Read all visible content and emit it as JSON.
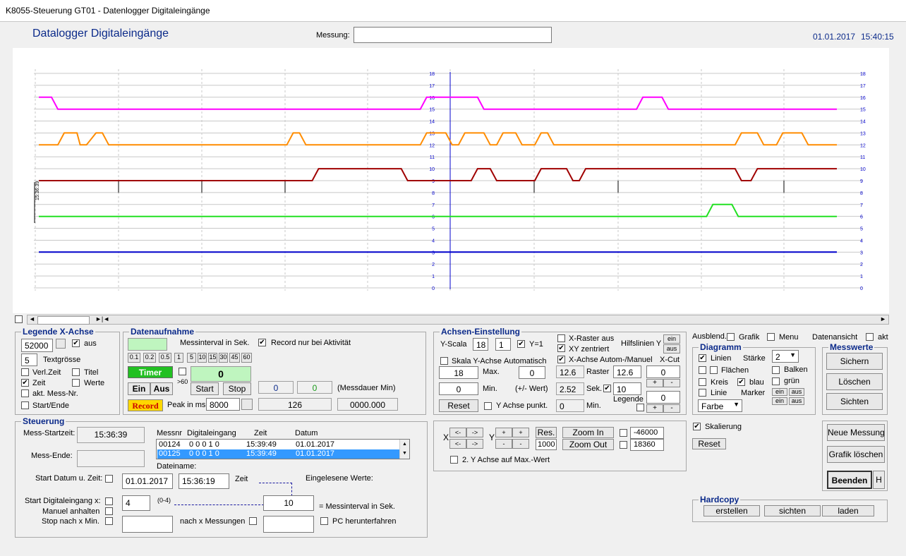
{
  "window": {
    "title": "K8055-Steuerung GT01 - Datenlogger Digitaleingänge"
  },
  "header": {
    "app_title": "Datalogger Digitaleingänge",
    "messung_label": "Messung:",
    "messung_value": "",
    "date": "01.01.2017",
    "time": "15:40:15"
  },
  "colors": {
    "magenta": "#ff00ff",
    "orange": "#ff8c00",
    "red": "#dd0000",
    "dark_red": "#a00000",
    "green": "#22e022",
    "blue": "#0000cc",
    "axis_text": "#0000cc",
    "title_blue": "#0b2a8a"
  },
  "chart_data": {
    "type": "line",
    "ylim": [
      0,
      18
    ],
    "yticks": [
      "0",
      "1",
      "2",
      "3",
      "4",
      "5",
      "6",
      "7",
      "8",
      "9",
      "10",
      "11",
      "12",
      "13",
      "14",
      "15",
      "16",
      "17",
      "18"
    ],
    "marker_label": "15:36:39",
    "series": [
      {
        "x": [
          0,
          15,
          25,
          430,
          440,
          570,
          580,
          680,
          690,
          710,
          720,
          760,
          770,
          780,
          790,
          830,
          840,
          850,
          860,
          1095,
          1105,
          1120,
          1130,
          1255
        ],
        "values": [
          9,
          9,
          9,
          9,
          10,
          10,
          9,
          9,
          10,
          10,
          9,
          9,
          9,
          9,
          10,
          10,
          9,
          9,
          10,
          10,
          9,
          9,
          10,
          10
        ]
      },
      {
        "x": [
          0,
          30,
          40,
          60,
          65,
          75,
          90,
          100,
          110,
          160,
          180,
          390,
          400,
          410,
          420,
          600,
          610,
          640,
          650,
          660,
          670,
          700,
          710,
          720,
          730,
          750,
          760,
          780,
          790,
          800,
          810,
          1095,
          1105,
          1130,
          1140,
          1160,
          1170,
          1200,
          1210,
          1255
        ],
        "values": [
          12,
          12,
          13,
          13,
          12,
          12,
          13,
          13,
          12,
          12,
          12,
          12,
          13,
          13,
          12,
          12,
          13,
          13,
          12,
          12,
          13,
          13,
          12,
          12,
          13,
          13,
          12,
          12,
          13,
          13,
          12,
          12,
          13,
          13,
          12,
          12,
          13,
          13,
          12,
          12
        ]
      },
      {
        "x": [
          0,
          20,
          30,
          600,
          610,
          690,
          700,
          940,
          950,
          980,
          990,
          1255
        ],
        "values": [
          16,
          16,
          15,
          15,
          16,
          16,
          15,
          15,
          16,
          16,
          15,
          15
        ]
      },
      {
        "x": [
          0,
          1050,
          1060,
          1090,
          1100,
          1255
        ],
        "values": [
          6,
          6,
          7,
          7,
          6,
          6
        ]
      },
      {
        "x": [
          0,
          1255
        ],
        "values": [
          3,
          3
        ]
      }
    ]
  },
  "scroll": {
    "left_arrow": "◄",
    "right_arrow": "►",
    "mid": "►|◄"
  },
  "legende": {
    "title": "Legende X-Achse",
    "value": "52000",
    "aus_label": "aus",
    "textgroesse_value": "5",
    "textgroesse_label": "Textgrösse",
    "verlzeit": "Verl.Zeit",
    "titel": "Titel",
    "zeit": "Zeit",
    "werte": "Werte",
    "akt_mess": "akt. Mess-Nr.",
    "start_ende": "Start/Ende"
  },
  "daten": {
    "title": "Datenaufnahme",
    "interval_label": "Messinterval in Sek.",
    "record_check": "Record nur bei Aktivität",
    "intervals": [
      "0.1",
      "0.2",
      "0.5",
      "1",
      "5",
      "10",
      "15",
      "30",
      "45",
      "60"
    ],
    "timer": "Timer",
    "gt60": ">60",
    "count_value": "0",
    "ein": "Ein",
    "aus": "Aus",
    "start": "Start",
    "stop": "Stop",
    "val1": "0",
    "val2": "0",
    "messdauer": "(Messdauer Min)",
    "record": "Record",
    "peak_label": "Peak in ms",
    "peak_value": "8000",
    "peak_count": "126",
    "time_total": "0000.000"
  },
  "achsen": {
    "title": "Achsen-Einstellung",
    "yscala": "Y-Scala",
    "yscala_val": "18",
    "yscala_val2": "1",
    "y1": "Y=1",
    "xraster": "X-Raster aus",
    "xyz": "XY zentriert",
    "xachse": "X-Achse Autom-/Manuel",
    "hilfslinien": "Hilfslinien Y",
    "ein": "ein",
    "aus": "aus",
    "skala_y": "Skala Y-Achse",
    "automatisch": "Automatisch",
    "xcut": "X-Cut",
    "max_val": "18",
    "max": "Max.",
    "auto_val": "0",
    "raster_val_ro": "12.6",
    "raster": "Raster",
    "raster_val": "12.6",
    "xcut_val": "0",
    "min_val": "0",
    "min": "Min.",
    "pm_wert": "(+/- Wert)",
    "sek_ro": "2.52",
    "sek": "Sek.",
    "sek_val": "10",
    "legende": "Legende",
    "legende_val": "0",
    "plus": "+",
    "minus": "-",
    "reset": "Reset",
    "y_achse_punkt": "Y Achse punkt.",
    "min_ro": "0",
    "min2": "Min."
  },
  "zoom": {
    "x": "X",
    "y": "Y",
    "left": "<-",
    "right": "->",
    "plus": "+",
    "minus": "-",
    "res": "Res.",
    "res_val": "1000",
    "zoom_in": "Zoom In",
    "zoom_out": "Zoom Out",
    "val1": "-46000",
    "val2": "18360",
    "second_y": "2. Y Achse auf Max.-Wert"
  },
  "ausblend": {
    "label": "Ausblend.",
    "grafik": "Grafik",
    "menu": "Menu",
    "datenansicht": "Datenansicht",
    "akt": "akt"
  },
  "diagramm": {
    "title": "Diagramm",
    "linien": "Linien",
    "staerke": "Stärke",
    "staerke_val": "2",
    "flaechen": "Flächen",
    "balken": "Balken",
    "kreis": "Kreis",
    "blau": "blau",
    "gruen": "grün",
    "linie": "Linie",
    "marker": "Marker",
    "farbe": "Farbe",
    "ein": "ein",
    "aus": "aus"
  },
  "messwerte": {
    "title": "Messwerte",
    "sichern": "Sichern",
    "loeschen": "Löschen",
    "sichten": "Sichten"
  },
  "skalierung": {
    "label": "Skalierung",
    "reset": "Reset"
  },
  "right_buttons": {
    "neue_messung": "Neue Messung",
    "grafik_loeschen": "Grafik löschen",
    "beenden": "Beenden",
    "h": "H"
  },
  "hardcopy": {
    "title": "Hardcopy",
    "erstellen": "erstellen",
    "sichten": "sichten",
    "laden": "laden"
  },
  "steuerung": {
    "title": "Steuerung",
    "mess_start_label": "Mess-Startzeit:",
    "mess_start_val": "15:36:39",
    "mess_ende_label": "Mess-Ende:",
    "cols": [
      "Messnr",
      "Digitaleingang",
      "Zeit",
      "Datum"
    ],
    "rows": [
      {
        "nr": "00124",
        "dig": "0 0 0 1 0",
        "zeit": "15:39:49",
        "datum": "01.01.2017"
      },
      {
        "nr": "00125",
        "dig": "0 0 0 1 0",
        "zeit": "15:39:49",
        "datum": "01.01.2017"
      }
    ],
    "dateiname": "Dateiname:",
    "start_datum_label": "Start Datum u. Zeit:",
    "start_datum": "01.01.2017",
    "start_zeit": "15:36:19",
    "zeit": "Zeit",
    "eingelesen": "Eingelesene Werte:",
    "start_dig_label": "Start Digitaleingang x:",
    "start_dig_val": "4",
    "range": "(0-4)",
    "mess_val": "10",
    "mess_label": "= Messinterval in Sek.",
    "manuel": "Manuel anhalten",
    "stop_nach": "Stop nach x Min.",
    "nach_x": "nach x Messungen",
    "pc_runter": "PC herunterfahren"
  }
}
